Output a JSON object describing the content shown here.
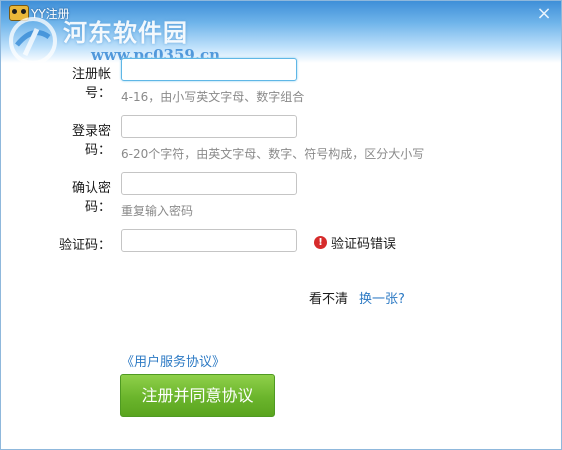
{
  "window": {
    "title": "YY注册",
    "close_label": "×"
  },
  "watermark": {
    "site_name": "河东软件园",
    "url": "www.pc0359.cn"
  },
  "form": {
    "account": {
      "label": "注册帐号：",
      "value": "",
      "hint": "4-16，由小写英文字母、数字组合"
    },
    "password": {
      "label": "登录密码：",
      "value": "",
      "hint": "6-20个字符，由英文字母、数字、符号构成，区分大小写"
    },
    "confirm": {
      "label": "确认密码：",
      "value": "",
      "hint": "重复输入密码"
    },
    "captcha": {
      "label": "验证码：",
      "value": "",
      "error": "验证码错误",
      "cant_see": "看不清",
      "refresh": "换一张?"
    },
    "agreement_link": "《用户服务协议》",
    "submit_label": "注册并同意协议"
  },
  "colors": {
    "accent": "#2d7ac4",
    "submit": "#6bb52c",
    "error": "#d62b2b",
    "focus_border": "#5fb7e6"
  }
}
